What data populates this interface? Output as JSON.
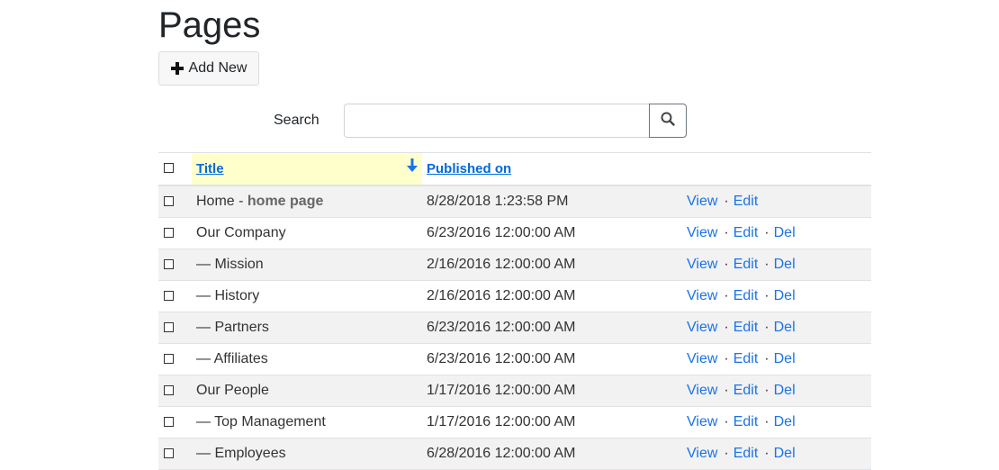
{
  "page": {
    "title": "Pages",
    "add_label": "Add New",
    "search_label": "Search",
    "search_value": "",
    "search_placeholder": ""
  },
  "table": {
    "columns": {
      "title": "Title",
      "published": "Published on"
    },
    "sort": {
      "column": "Title",
      "direction": "descending"
    },
    "rows": [
      {
        "title": "Home",
        "subtitle": "home page",
        "date": "8/28/2018 1:23:58 PM",
        "view": "View",
        "edit": "Edit",
        "del": ""
      },
      {
        "title": "Our Company",
        "subtitle": "",
        "date": "6/23/2016 12:00:00 AM",
        "view": "View",
        "edit": "Edit",
        "del": "Del"
      },
      {
        "title": "— Mission",
        "subtitle": "",
        "date": "2/16/2016 12:00:00 AM",
        "view": "View",
        "edit": "Edit",
        "del": "Del"
      },
      {
        "title": "— History",
        "subtitle": "",
        "date": "2/16/2016 12:00:00 AM",
        "view": "View",
        "edit": "Edit",
        "del": "Del"
      },
      {
        "title": "— Partners",
        "subtitle": "",
        "date": "6/23/2016 12:00:00 AM",
        "view": "View",
        "edit": "Edit",
        "del": "Del"
      },
      {
        "title": "— Affiliates",
        "subtitle": "",
        "date": "6/23/2016 12:00:00 AM",
        "view": "View",
        "edit": "Edit",
        "del": "Del"
      },
      {
        "title": "Our People",
        "subtitle": "",
        "date": "1/17/2016 12:00:00 AM",
        "view": "View",
        "edit": "Edit",
        "del": "Del"
      },
      {
        "title": "— Top Management",
        "subtitle": "",
        "date": "1/17/2016 12:00:00 AM",
        "view": "View",
        "edit": "Edit",
        "del": "Del"
      },
      {
        "title": "— Employees",
        "subtitle": "",
        "date": "6/28/2016 12:00:00 AM",
        "view": "View",
        "edit": "Edit",
        "del": "Del"
      }
    ]
  },
  "icons": {
    "add": "plus-icon",
    "search": "search-icon",
    "sort": "arrow-down-icon"
  },
  "colors": {
    "link": "#1a73e8",
    "header_link": "#0069d9",
    "sorted_column_bg": "#ffffcc",
    "striped_row_bg": "#f2f2f2"
  }
}
